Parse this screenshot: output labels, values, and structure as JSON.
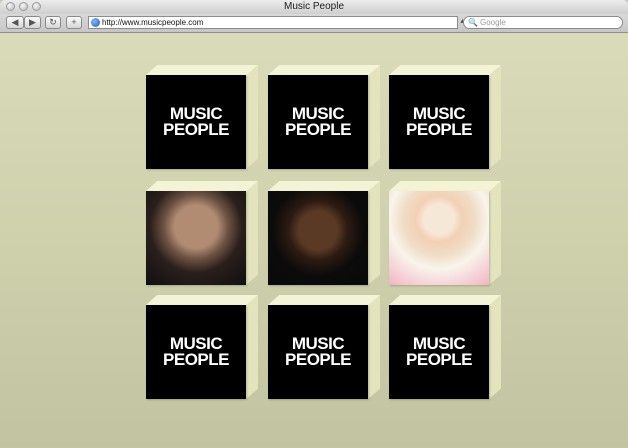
{
  "window": {
    "title": "Music People"
  },
  "toolbar": {
    "back_icon": "back-arrow",
    "forward_icon": "forward-arrow",
    "reload_icon": "reload",
    "add_icon": "plus",
    "url": "http://www.musicpeople.com",
    "search_placeholder": "Google"
  },
  "tiles": [
    {
      "kind": "logo",
      "line1": "MUSIC",
      "line2": "PEOPLE"
    },
    {
      "kind": "logo",
      "line1": "MUSIC",
      "line2": "PEOPLE"
    },
    {
      "kind": "logo",
      "line1": "MUSIC",
      "line2": "PEOPLE"
    },
    {
      "kind": "photo"
    },
    {
      "kind": "photo"
    },
    {
      "kind": "photo"
    },
    {
      "kind": "logo",
      "line1": "MUSIC",
      "line2": "PEOPLE"
    },
    {
      "kind": "logo",
      "line1": "MUSIC",
      "line2": "PEOPLE"
    },
    {
      "kind": "logo",
      "line1": "MUSIC",
      "line2": "PEOPLE"
    }
  ]
}
